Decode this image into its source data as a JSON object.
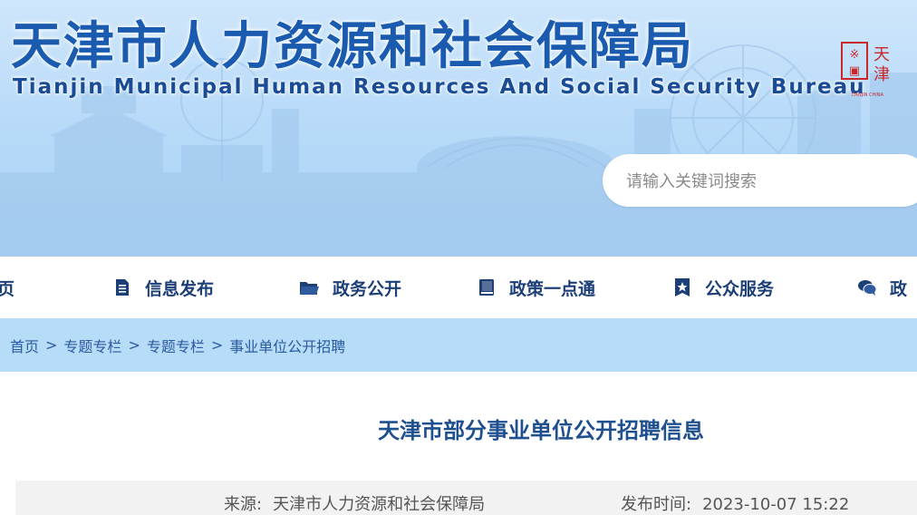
{
  "header": {
    "title_cn": "天津市人力资源和社会保障局",
    "title_en": "Tianjin Municipal Human Resources And Social Security Bureau",
    "seal_text": "天津",
    "seal_subtext": "TIANJIN CHINA"
  },
  "search": {
    "placeholder": "请输入关键词搜索"
  },
  "nav": {
    "items": [
      {
        "label": "页",
        "icon": "home-icon"
      },
      {
        "label": "信息发布",
        "icon": "document-icon"
      },
      {
        "label": "政务公开",
        "icon": "folder-icon"
      },
      {
        "label": "政策一点通",
        "icon": "book-icon"
      },
      {
        "label": "公众服务",
        "icon": "star-badge-icon"
      },
      {
        "label": "政",
        "icon": "chat-icon"
      }
    ]
  },
  "breadcrumb": {
    "items": [
      "首页",
      "专题专栏",
      "专题专栏",
      "事业单位公开招聘"
    ],
    "separator": ">"
  },
  "article": {
    "title": "天津市部分事业单位公开招聘信息",
    "source_label": "来源:",
    "source": "天津市人力资源和社会保障局",
    "time_label": "发布时间:",
    "time": "2023-10-07 15:22"
  },
  "colors": {
    "title_blue": "#1a5bb0",
    "nav_text": "#1d3f77",
    "breadcrumb_bg": "#b7dcf8",
    "seal_red": "#c8282a"
  }
}
